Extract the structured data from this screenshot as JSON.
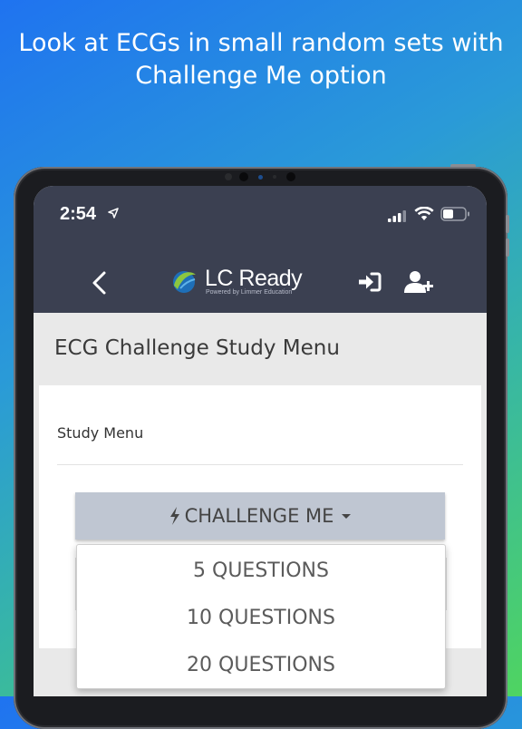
{
  "caption": {
    "line1": "Look at ECGs in small random sets with",
    "line2": "Challenge Me option"
  },
  "status_bar": {
    "time": "2:54"
  },
  "header": {
    "logo_text": "LC Ready",
    "logo_subtitle": "Powered by Limmer Education",
    "back_icon": "chevron-left-icon",
    "login_icon": "sign-in-icon",
    "add_user_icon": "user-plus-icon"
  },
  "page": {
    "title": "ECG Challenge Study Menu",
    "section_label": "Study Menu"
  },
  "challenge_button": {
    "label": "CHALLENGE ME"
  },
  "dropdown": {
    "options": [
      "5 QUESTIONS",
      "10 QUESTIONS",
      "20 QUESTIONS"
    ]
  },
  "colors": {
    "appbar": "#3b4051",
    "button": "#bfc6d2",
    "accent_green": "#8cc63f",
    "accent_blue": "#1e6fb8"
  }
}
